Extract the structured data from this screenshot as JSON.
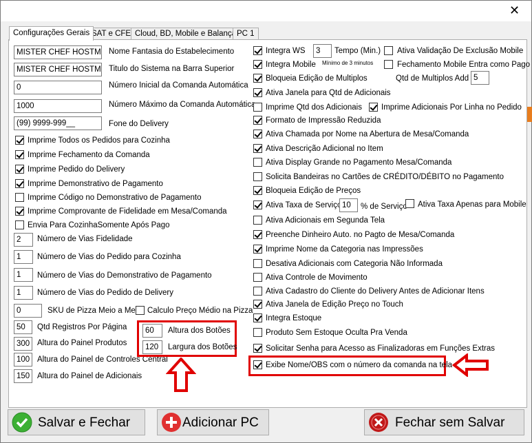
{
  "window": {
    "close_glyph": "✕"
  },
  "tabs": [
    "Configurações Gerais",
    "SAT e CFE",
    "Cloud, BD, Mobile e Balança",
    "PC 1"
  ],
  "left": {
    "fields": [
      {
        "value": "MISTER CHEF HOSTMU",
        "label": "Nome Fantasia do Estabelecimento"
      },
      {
        "value": "MISTER CHEF HOSTMU",
        "label": "Titulo do Sistema na Barra Superior"
      },
      {
        "value": "0",
        "label": "Número Inicial da Comanda Automática"
      },
      {
        "value": "1000",
        "label": "Número Máximo da Comanda Automática"
      },
      {
        "value": "(99) 9999-999__",
        "label": "Fone do Delivery"
      }
    ],
    "checks": [
      {
        "label": "Imprime Todos os Pedidos para Cozinha",
        "checked": true
      },
      {
        "label": "Imprime Fechamento da Comanda",
        "checked": true
      },
      {
        "label": "Imprime Pedido do Delivery",
        "checked": true
      },
      {
        "label": "Imprime Demonstrativo de Pagamento",
        "checked": true
      },
      {
        "label": "Imprime Código no Demonstrativo de Pagamento",
        "checked": false
      },
      {
        "label": "Imprime Comprovante de Fidelidade em Mesa/Comanda",
        "checked": true
      },
      {
        "label": "Envia Para CozinhaSomente Após Pago",
        "checked": false
      }
    ],
    "vias": [
      {
        "value": "2",
        "label": "Número de Vias Fidelidade"
      },
      {
        "value": "1",
        "label": "Número de Vias do Pedido para Cozinha"
      },
      {
        "value": "1",
        "label": "Número de Vias do Demonstrativo de Pagamento"
      },
      {
        "value": "1",
        "label": "Número de Vias do Pedido de Delivery"
      }
    ],
    "sku": {
      "value": "0",
      "label": "SKU de Pizza Meio a Meio",
      "calc_label": "Calculo Preço Médio na Pizza",
      "calc_checked": false
    },
    "panel_fields": [
      {
        "value": "50",
        "label": "Qtd Registros Por Página"
      },
      {
        "value": "300",
        "label": "Altura do Painel Produtos"
      },
      {
        "value": "100",
        "label": "Altura do Painel de Controles Central"
      },
      {
        "value": "150",
        "label": "Altura do Painel de Adicionais"
      }
    ],
    "buttons_size": [
      {
        "value": "60",
        "label": "Altura dos Botões"
      },
      {
        "value": "120",
        "label": "Largura dos Botões"
      }
    ]
  },
  "right": {
    "integra_ws": {
      "label": "Integra WS",
      "checked": true,
      "tempo_value": "3",
      "tempo_label": "Tempo (Min.)",
      "min_note": "Mínimo de 3 minutos"
    },
    "ativa_validacao": {
      "label": "Ativa Validação De Exclusão Mobile",
      "checked": false
    },
    "integra_mobile": {
      "label": "Integra Mobile",
      "checked": true
    },
    "fechamento_mobile": {
      "label": "Fechamento Mobile Entra como Pago",
      "checked": false
    },
    "bloqueia_multiplos": {
      "label": "Bloqueia Edição de Multiplos",
      "checked": true
    },
    "qtd_multiplos": {
      "label": "Qtd de Multiplos Add",
      "value": "5"
    },
    "janela_adicionais": {
      "label": "Ativa Janela para Qtd de Adicionais",
      "checked": true
    },
    "imprime_qtd": {
      "label": "Imprime Qtd dos Adicionais",
      "checked": false
    },
    "imprime_por_linha": {
      "label": "Imprime Adicionais Por Linha no Pedido",
      "checked": true
    },
    "checks": [
      {
        "label": "Formato de Impressão Reduzida",
        "checked": true
      },
      {
        "label": "Ativa Chamada por Nome na Abertura de Mesa/Comanda",
        "checked": true
      },
      {
        "label": "Ativa Descrição Adicional no Item",
        "checked": true
      },
      {
        "label": "Ativa Display Grande no Pagamento Mesa/Comanda",
        "checked": false
      },
      {
        "label": "Solicita Bandeiras no Cartões de CRÉDITO/DÉBITO no Pagamento",
        "checked": false
      },
      {
        "label": "Bloqueia Edição de Preços",
        "checked": true
      }
    ],
    "taxa": {
      "label": "Ativa Taxa de Serviço",
      "checked": true,
      "value": "10",
      "pct_label": "% de Serviço",
      "apenas_label": "Ativa Taxa Apenas para Mobile",
      "apenas_checked": false
    },
    "checks2": [
      {
        "label": "Ativa Adicionais em Segunda Tela",
        "checked": false
      },
      {
        "label": "Preenche Dinheiro Auto. no Pagto de Mesa/Comanda",
        "checked": true
      },
      {
        "label": "Imprime Nome da Categoria nas Impressões",
        "checked": true
      },
      {
        "label": "Desativa Adicionais com Categoria Não Informada",
        "checked": false
      },
      {
        "label": "Ativa Controle de Movimento",
        "checked": false
      },
      {
        "label": "Ativa Cadastro do Cliente do Delivery Antes de Adicionar Itens",
        "checked": false
      },
      {
        "label": "Ativa Janela de Edição Preço no Touch",
        "checked": true
      },
      {
        "label": "Integra Estoque",
        "checked": true
      },
      {
        "label": "Produto Sem Estoque Oculta Pra Venda",
        "checked": false
      },
      {
        "label": "Solicitar Senha para Acesso as Finalizadoras em Funções Extras",
        "checked": true
      },
      {
        "label": "Exibe Nome/OBS com o número da comanda na tela",
        "checked": true
      }
    ]
  },
  "buttons": {
    "save": "Salvar e Fechar",
    "add_pc": "Adicionar PC",
    "close": "Fechar sem Salvar"
  },
  "colors": {
    "highlight": "#e00000",
    "save_icon": "#3cb034",
    "add_icon": "#e03030",
    "close_icon": "#c01818"
  }
}
